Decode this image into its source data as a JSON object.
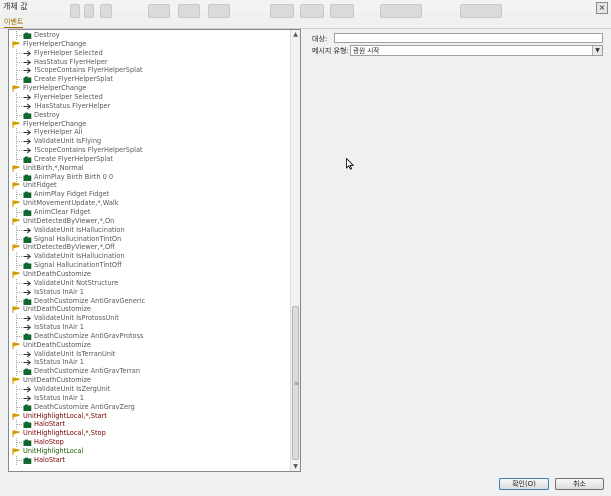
{
  "window": {
    "title": "개체 값",
    "close_glyph": "×"
  },
  "tabs": {
    "event_label": "이벤트"
  },
  "form": {
    "target_label": "대상:",
    "target_value": "",
    "message_type_label": "메시지 유형:",
    "message_type_value": "광원 시작"
  },
  "buttons": {
    "ok": "확인(O)",
    "cancel": "취소"
  },
  "colors": {
    "event_icon": "#d49a00",
    "action_icon": "#0b6b2d",
    "highlight_red": "#7a0000",
    "highlight_green": "#1d5a00"
  },
  "tree": [
    {
      "kind": "action",
      "text": "Destroy"
    },
    {
      "kind": "event",
      "text": "FlyerHelperChange"
    },
    {
      "kind": "cond",
      "text": "FlyerHelper Selected"
    },
    {
      "kind": "cond",
      "text": "HasStatus FlyerHelper"
    },
    {
      "kind": "cond",
      "text": "!ScopeContains FlyerHelperSplat"
    },
    {
      "kind": "action",
      "text": "Create FlyerHelperSplat"
    },
    {
      "kind": "event",
      "text": "FlyerHelperChange"
    },
    {
      "kind": "cond",
      "text": "FlyerHelper Selected"
    },
    {
      "kind": "cond",
      "text": "!HasStatus FlyerHelper"
    },
    {
      "kind": "action",
      "text": "Destroy"
    },
    {
      "kind": "event",
      "text": "FlyerHelperChange"
    },
    {
      "kind": "cond",
      "text": "FlyerHelper All"
    },
    {
      "kind": "cond",
      "text": "ValidateUnit IsFlying"
    },
    {
      "kind": "cond",
      "text": "!ScopeContains FlyerHelperSplat"
    },
    {
      "kind": "action",
      "text": "Create FlyerHelperSplat"
    },
    {
      "kind": "event",
      "text": "UnitBirth,*,Normal"
    },
    {
      "kind": "action",
      "text": "AnimPlay Birth Birth 0 0"
    },
    {
      "kind": "event",
      "text": "UnitFidget"
    },
    {
      "kind": "action",
      "text": "AnimPlay Fidget Fidget"
    },
    {
      "kind": "event",
      "text": "UnitMovementUpdate,*,Walk"
    },
    {
      "kind": "action",
      "text": "AnimClear Fidget"
    },
    {
      "kind": "event",
      "text": "UnitDetectedByViewer,*,On"
    },
    {
      "kind": "cond",
      "text": "ValidateUnit IsHallucination"
    },
    {
      "kind": "action",
      "text": "Signal HallucinationTintOn"
    },
    {
      "kind": "event",
      "text": "UnitDetectedByViewer,*,Off"
    },
    {
      "kind": "cond",
      "text": "ValidateUnit IsHallucination"
    },
    {
      "kind": "action",
      "text": "Signal HallucinationTintOff"
    },
    {
      "kind": "event",
      "text": "UnitDeathCustomize"
    },
    {
      "kind": "cond",
      "text": "ValidateUnit NotStructure"
    },
    {
      "kind": "cond",
      "text": "IsStatus InAir 1"
    },
    {
      "kind": "action",
      "text": "DeathCustomize AntiGravGeneric"
    },
    {
      "kind": "event",
      "text": "UnitDeathCustomize"
    },
    {
      "kind": "cond",
      "text": "ValidateUnit IsProtossUnit"
    },
    {
      "kind": "cond",
      "text": "IsStatus InAir 1"
    },
    {
      "kind": "action",
      "text": "DeathCustomize AntiGravProtoss"
    },
    {
      "kind": "event",
      "text": "UnitDeathCustomize"
    },
    {
      "kind": "cond",
      "text": "ValidateUnit IsTerranUnit"
    },
    {
      "kind": "cond",
      "text": "IsStatus InAir 1"
    },
    {
      "kind": "action",
      "text": "DeathCustomize AntiGravTerran"
    },
    {
      "kind": "event",
      "text": "UnitDeathCustomize"
    },
    {
      "kind": "cond",
      "text": "ValidateUnit IsZergUnit"
    },
    {
      "kind": "cond",
      "text": "IsStatus InAir 1"
    },
    {
      "kind": "action",
      "text": "DeathCustomize AntiGravZerg"
    },
    {
      "kind": "event",
      "text": "UnitHighlightLocal,*,Start",
      "style": "hl"
    },
    {
      "kind": "action",
      "text": "HaloStart",
      "style": "hl"
    },
    {
      "kind": "event",
      "text": "UnitHighlightLocal,*,Stop",
      "style": "hl"
    },
    {
      "kind": "action",
      "text": "HaloStop",
      "style": "hl"
    },
    {
      "kind": "event",
      "text": "UnitHighlightLocal",
      "style": "hlg"
    },
    {
      "kind": "action",
      "text": "HaloStart",
      "style": "hl"
    }
  ]
}
